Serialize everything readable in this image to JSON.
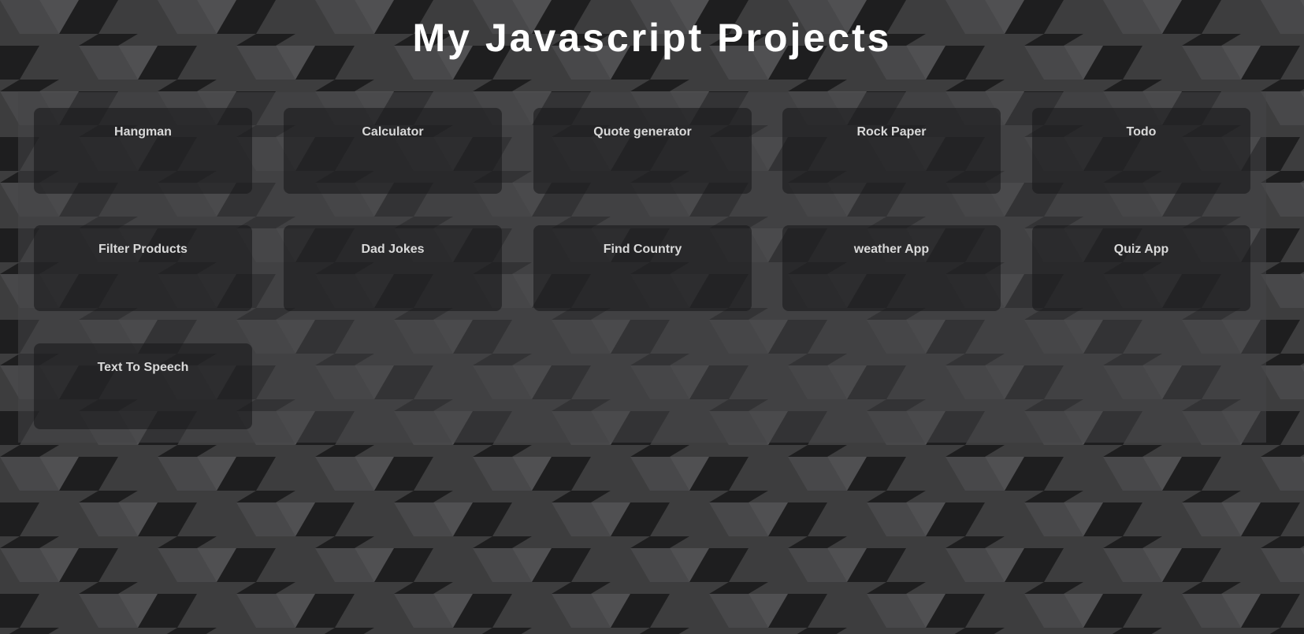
{
  "page": {
    "title": "My Javascript Projects"
  },
  "theme": {
    "background_dark": "#1e1e1f",
    "background_mid": "#3d3d3e",
    "background_light": "#505052",
    "title_color": "#ffffff",
    "card_label_color": "#d9d9d9"
  },
  "projects": [
    {
      "label": "Hangman"
    },
    {
      "label": "Calculator"
    },
    {
      "label": "Quote generator"
    },
    {
      "label": "Rock Paper"
    },
    {
      "label": "Todo"
    },
    {
      "label": "Filter Products"
    },
    {
      "label": "Dad Jokes"
    },
    {
      "label": "Find Country"
    },
    {
      "label": "weather App"
    },
    {
      "label": "Quiz App"
    },
    {
      "label": "Text To Speech"
    }
  ]
}
